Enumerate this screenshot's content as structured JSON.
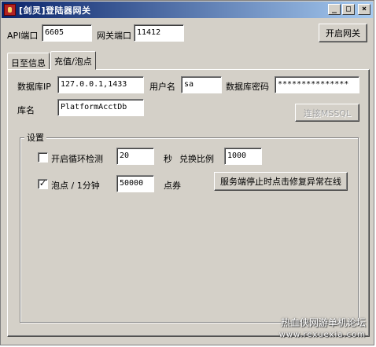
{
  "window": {
    "title": "[剑灵]登陆器网关",
    "minimize_glyph": "_",
    "maximize_glyph": "□",
    "close_glyph": "×"
  },
  "top": {
    "api_port_label": "API端口",
    "api_port_value": "6605",
    "gateway_port_label": "网关端口",
    "gateway_port_value": "11412",
    "start_gateway_button": "开启网关"
  },
  "tabs": [
    {
      "label": "日至信息",
      "active": false
    },
    {
      "label": "充值/泡点",
      "active": true
    }
  ],
  "db": {
    "ip_label": "数据库IP",
    "ip_value": "127.0.0.1,1433",
    "user_label": "用户名",
    "user_value": "sa",
    "password_label": "数据库密码",
    "password_value": "***************",
    "dbname_label": "库名",
    "dbname_value": "PlatformAcctDb",
    "connect_button": "连接MSSQL"
  },
  "settings": {
    "group_title": "设置",
    "loop_check_label": "开启循环检测",
    "loop_check_checked": false,
    "loop_interval_value": "20",
    "seconds_label": "秒",
    "ratio_label": "兑换比例",
    "ratio_value": "1000",
    "bubble_label": "泡点 / 1分钟",
    "bubble_checked": true,
    "bubble_value": "50000",
    "points_label": "点券",
    "repair_button": "服务端停止时点击修复异常在线"
  },
  "watermark": {
    "line1": "热血侠网游单机论坛",
    "line2": "www.rexuexia.com"
  }
}
